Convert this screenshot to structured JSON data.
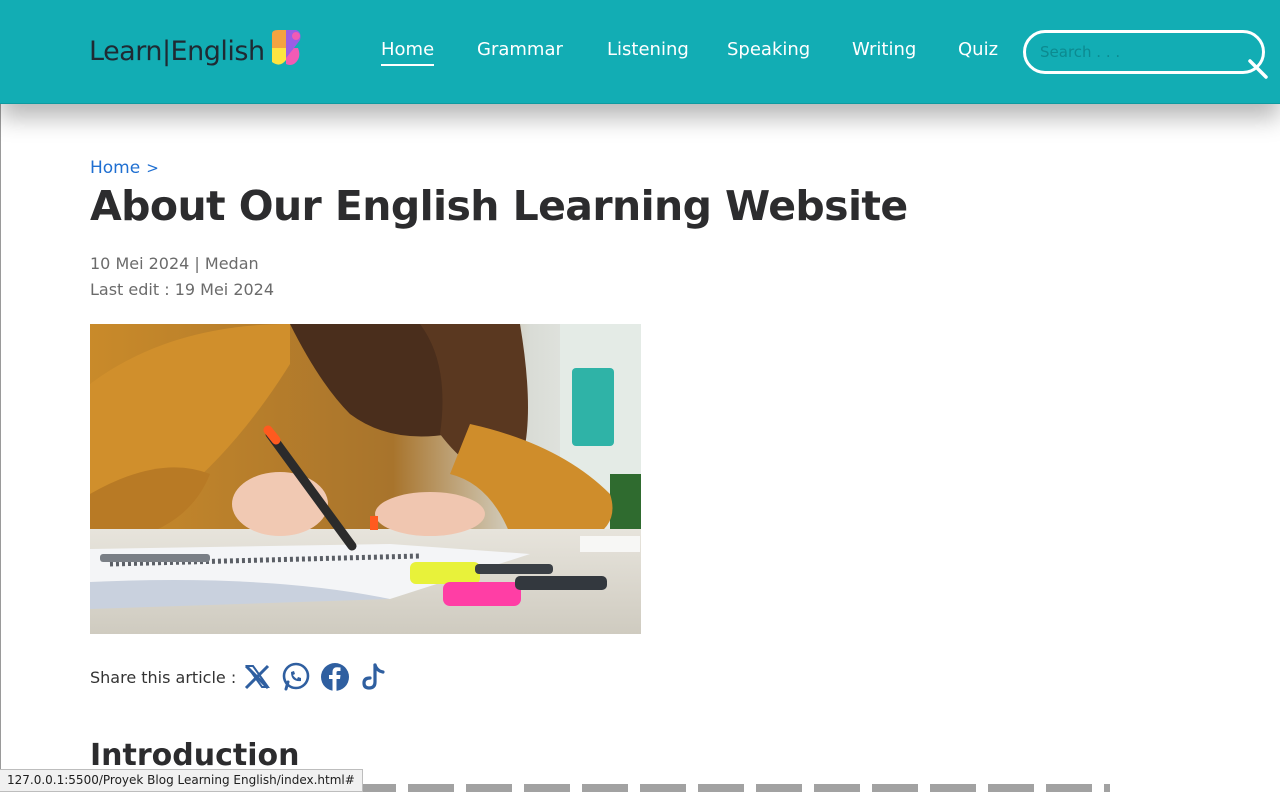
{
  "brand": {
    "logo_text": "Learn|English",
    "mark_colors": [
      "#f4a340",
      "#9b5de5",
      "#f15bb5",
      "#fee440"
    ]
  },
  "nav": {
    "items": [
      {
        "label": "Home",
        "active": true
      },
      {
        "label": "Grammar",
        "active": false
      },
      {
        "label": "Listening",
        "active": false
      },
      {
        "label": "Speaking",
        "active": false
      },
      {
        "label": "Writing",
        "active": false
      },
      {
        "label": "Quiz",
        "active": false
      }
    ]
  },
  "search": {
    "placeholder": "Search . . .",
    "value": "",
    "icon": "search-icon"
  },
  "breadcrumb": {
    "home": "Home",
    "separator": ">"
  },
  "article": {
    "title": "About Our English Learning Website",
    "date_line": "10 Mei 2024 | Medan",
    "edit_line": "Last edit : 19 Mei 2024",
    "image_subject": "student-writing-with-highlighter",
    "share_label": "Share this article :",
    "share_icons": [
      "x-icon",
      "whatsapp-icon",
      "facebook-icon",
      "tiktok-icon"
    ],
    "section_title": "Introduction"
  },
  "status_bar": {
    "url": "127.0.0.1:5500/Proyek Blog Learning English/index.html#"
  },
  "colors": {
    "navbar": "#12adb4",
    "link": "#1f6fd1",
    "title": "#2c2c2e",
    "share_icon": "#2f5fa0"
  }
}
